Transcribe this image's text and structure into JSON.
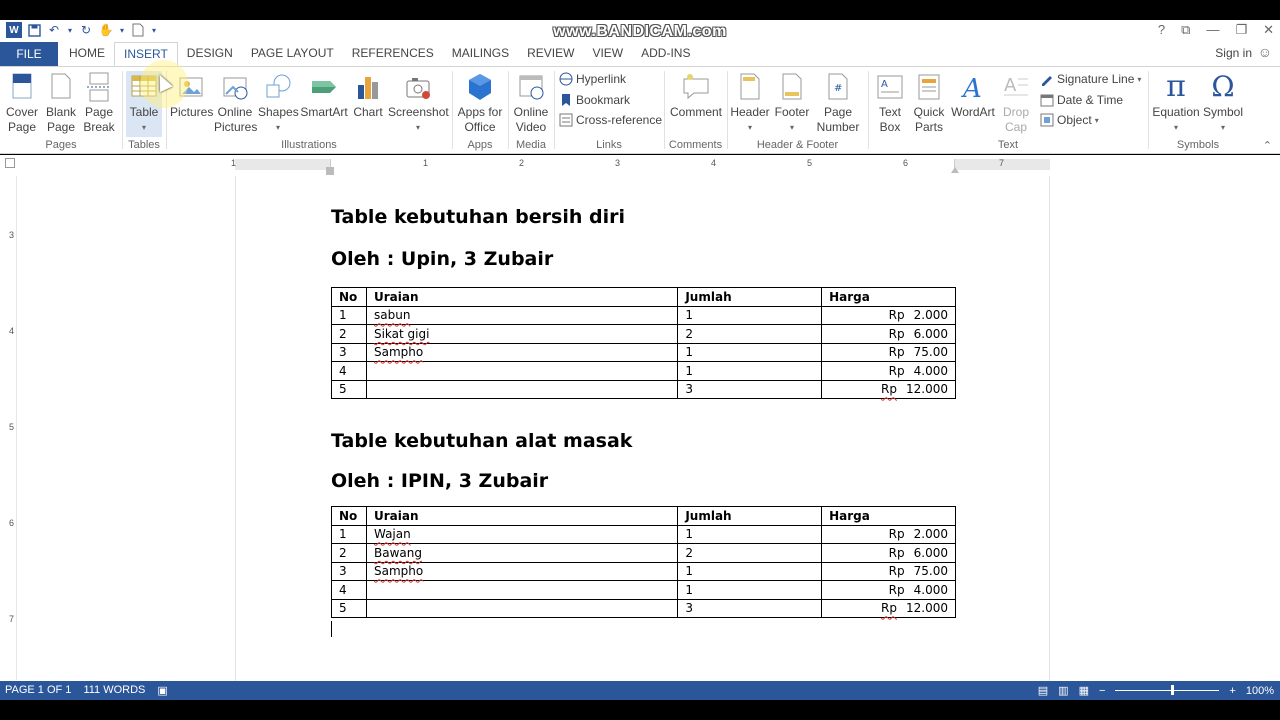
{
  "watermark": "www.BANDICAM.com",
  "colors": {
    "accent": "#2b579a",
    "squiggle": "#e03030"
  },
  "tabs": {
    "file": "FILE",
    "items": [
      "HOME",
      "INSERT",
      "DESIGN",
      "PAGE LAYOUT",
      "REFERENCES",
      "MAILINGS",
      "REVIEW",
      "VIEW",
      "ADD-INS"
    ],
    "active": "INSERT"
  },
  "signin": "Sign in",
  "ribbon": {
    "cover_page": "Cover\nPage",
    "blank_page": "Blank\nPage",
    "page_break": "Page\nBreak",
    "table": "Table",
    "pictures": "Pictures",
    "online_pictures": "Online\nPictures",
    "shapes": "Shapes",
    "smartart": "SmartArt",
    "chart": "Chart",
    "screenshot": "Screenshot",
    "apps_for_office": "Apps for\nOffice",
    "online_video": "Online\nVideo",
    "hyperlink": "Hyperlink",
    "bookmark": "Bookmark",
    "cross_reference": "Cross-reference",
    "comment": "Comment",
    "header": "Header",
    "footer": "Footer",
    "page_number": "Page\nNumber",
    "text_box": "Text\nBox",
    "quick_parts": "Quick\nParts",
    "wordart": "WordArt",
    "drop_cap": "Drop\nCap",
    "signature_line": "Signature Line",
    "date_time": "Date & Time",
    "object": "Object",
    "equation": "Equation",
    "symbol": "Symbol",
    "groups": {
      "pages": "Pages",
      "tables": "Tables",
      "illustrations": "Illustrations",
      "apps": "Apps",
      "media": "Media",
      "links": "Links",
      "comments": "Comments",
      "header_footer": "Header & Footer",
      "text": "Text",
      "symbols": "Symbols"
    }
  },
  "ruler": {
    "h_numbers": [
      "1",
      "1",
      "2",
      "3",
      "4",
      "5",
      "6",
      "7"
    ],
    "v_numbers": [
      "3",
      "4",
      "5",
      "6",
      "7"
    ]
  },
  "document": {
    "section1": {
      "title": "Table kebutuhan bersih diri",
      "author": "Oleh : Upin, 3 Zubair",
      "headers": [
        "No",
        "Uraian",
        "Jumlah",
        "Harga"
      ],
      "rows": [
        {
          "no": "1",
          "uraian": "sabun",
          "jumlah": "1",
          "rp": "Rp",
          "harga": "2.000"
        },
        {
          "no": "2",
          "uraian": "Sikat gigi",
          "jumlah": "2",
          "rp": "Rp",
          "harga": "6.000"
        },
        {
          "no": "3",
          "uraian": "Sampho",
          "jumlah": "1",
          "rp": "Rp",
          "harga": "75.00"
        },
        {
          "no": "4",
          "uraian": "",
          "jumlah": "1",
          "rp": "Rp",
          "harga": "4.000"
        },
        {
          "no": "5",
          "uraian": "",
          "jumlah": "3",
          "rp": "Rp",
          "harga": "12.000"
        }
      ]
    },
    "section2": {
      "title": "Table kebutuhan alat masak",
      "author": "Oleh : IPIN, 3 Zubair",
      "headers": [
        "No",
        "Uraian",
        "Jumlah",
        "Harga"
      ],
      "rows": [
        {
          "no": "1",
          "uraian": "Wajan",
          "jumlah": "1",
          "rp": "Rp",
          "harga": "2.000"
        },
        {
          "no": "2",
          "uraian": "Bawang",
          "jumlah": "2",
          "rp": "Rp",
          "harga": "6.000"
        },
        {
          "no": "3",
          "uraian": "Sampho",
          "jumlah": "1",
          "rp": "Rp",
          "harga": "75.00"
        },
        {
          "no": "4",
          "uraian": "",
          "jumlah": "1",
          "rp": "Rp",
          "harga": "4.000"
        },
        {
          "no": "5",
          "uraian": "",
          "jumlah": "3",
          "rp": "Rp",
          "harga": "12.000"
        }
      ]
    }
  },
  "status": {
    "page": "PAGE 1 OF 1",
    "words": "111 WORDS",
    "zoom": "100%"
  }
}
